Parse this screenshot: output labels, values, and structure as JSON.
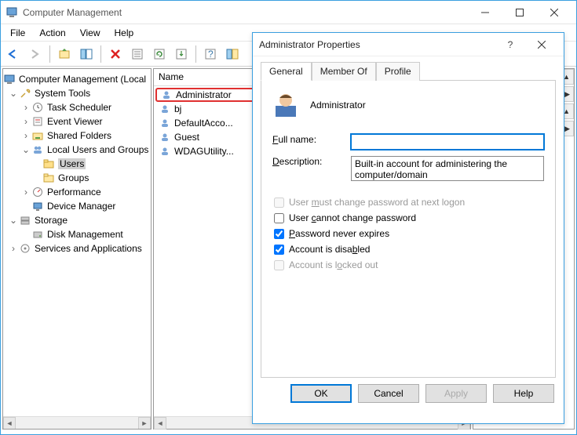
{
  "window": {
    "title": "Computer Management",
    "menu": [
      "File",
      "Action",
      "View",
      "Help"
    ]
  },
  "tree": {
    "root": "Computer Management (Local",
    "nodes": {
      "system_tools": "System Tools",
      "task_scheduler": "Task Scheduler",
      "event_viewer": "Event Viewer",
      "shared_folders": "Shared Folders",
      "local_users": "Local Users and Groups",
      "users": "Users",
      "groups": "Groups",
      "performance": "Performance",
      "device_manager": "Device Manager",
      "storage": "Storage",
      "disk_management": "Disk Management",
      "services_apps": "Services and Applications"
    }
  },
  "list": {
    "header_name": "Name",
    "items": [
      {
        "label": "Administrator"
      },
      {
        "label": "bj"
      },
      {
        "label": "DefaultAcco..."
      },
      {
        "label": "Guest"
      },
      {
        "label": "WDAGUtility..."
      }
    ]
  },
  "dialog": {
    "title": "Administrator Properties",
    "tabs": {
      "general": "General",
      "member_of": "Member Of",
      "profile": "Profile"
    },
    "username": "Administrator",
    "full_name_label": "Full name:",
    "full_name_value": "",
    "description_label": "Description:",
    "description_value": "Built-in account for administering the computer/domain",
    "checkboxes": {
      "must_change": "User must change password at next logon",
      "cannot_change": "User cannot change password",
      "never_expires": "Password never expires",
      "disabled": "Account is disabled",
      "locked_out": "Account is locked out"
    },
    "buttons": {
      "ok": "OK",
      "cancel": "Cancel",
      "apply": "Apply",
      "help": "Help"
    }
  }
}
